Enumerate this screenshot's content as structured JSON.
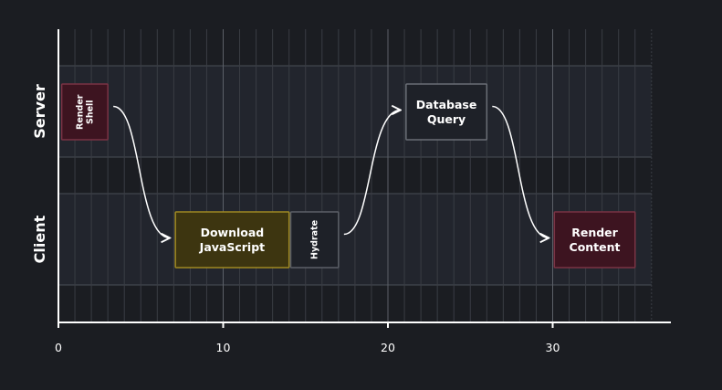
{
  "lanes": [
    {
      "label": "Server"
    },
    {
      "label": "Client"
    }
  ],
  "axis": {
    "ticks": [
      {
        "value": 0,
        "label": "0"
      },
      {
        "value": 10,
        "label": "10"
      },
      {
        "value": 20,
        "label": "20"
      },
      {
        "value": 30,
        "label": "30"
      }
    ],
    "max": 36
  },
  "tasks": [
    {
      "label": "Render\nShell",
      "lane": "Server",
      "start": 0.2,
      "end": 3.0,
      "vertical": true,
      "fill": "#3d1420",
      "stroke": "#7a3344"
    },
    {
      "label": "Download\nJavaScript",
      "lane": "Client",
      "start": 7.1,
      "end": 14.0,
      "vertical": false,
      "fill": "#3d3510",
      "stroke": "#a08a22"
    },
    {
      "label": "Hydrate",
      "lane": "Client",
      "start": 14.1,
      "end": 17.0,
      "vertical": true,
      "fill": "#1e2128",
      "stroke": "#5c6068"
    },
    {
      "label": "Database\nQuery",
      "lane": "Server",
      "start": 21.1,
      "end": 26.0,
      "vertical": false,
      "fill": "#1e2128",
      "stroke": "#6a6e76"
    },
    {
      "label": "Render\nContent",
      "lane": "Client",
      "start": 30.1,
      "end": 35.0,
      "vertical": false,
      "fill": "#3d1420",
      "stroke": "#7a3344"
    }
  ]
}
